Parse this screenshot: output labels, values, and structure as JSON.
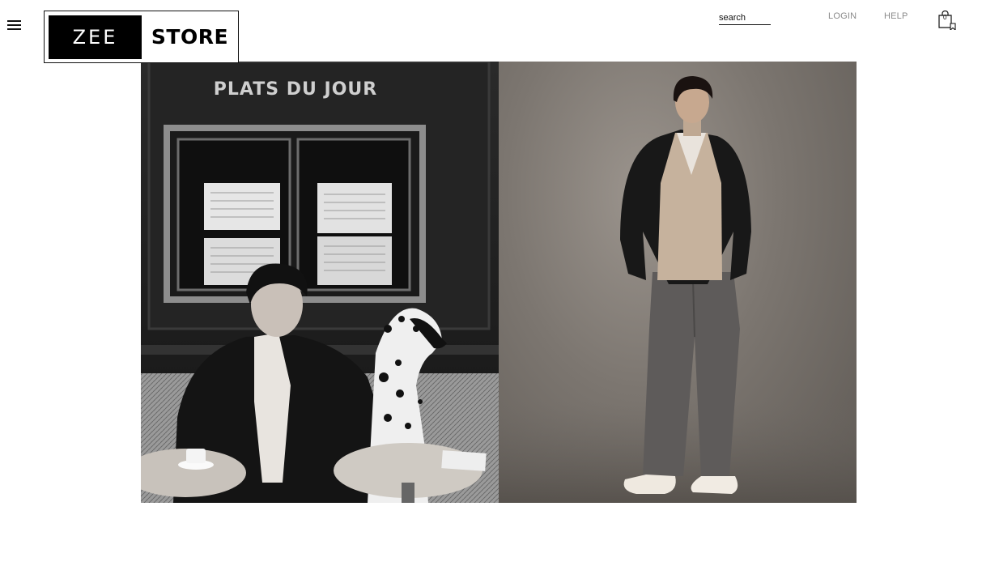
{
  "header": {
    "menu_icon": "hamburger-menu-icon",
    "logo": {
      "left": "ZEE",
      "right": "STORE"
    },
    "search": {
      "placeholder": "search",
      "value": ""
    },
    "nav": {
      "login": "LOGIN",
      "help": "HELP"
    },
    "cart": {
      "icon": "shopping-bag-icon",
      "count": "0"
    }
  },
  "hero": {
    "left_image": {
      "sign_text": "PLATS DU JOUR"
    },
    "right_image": {}
  }
}
